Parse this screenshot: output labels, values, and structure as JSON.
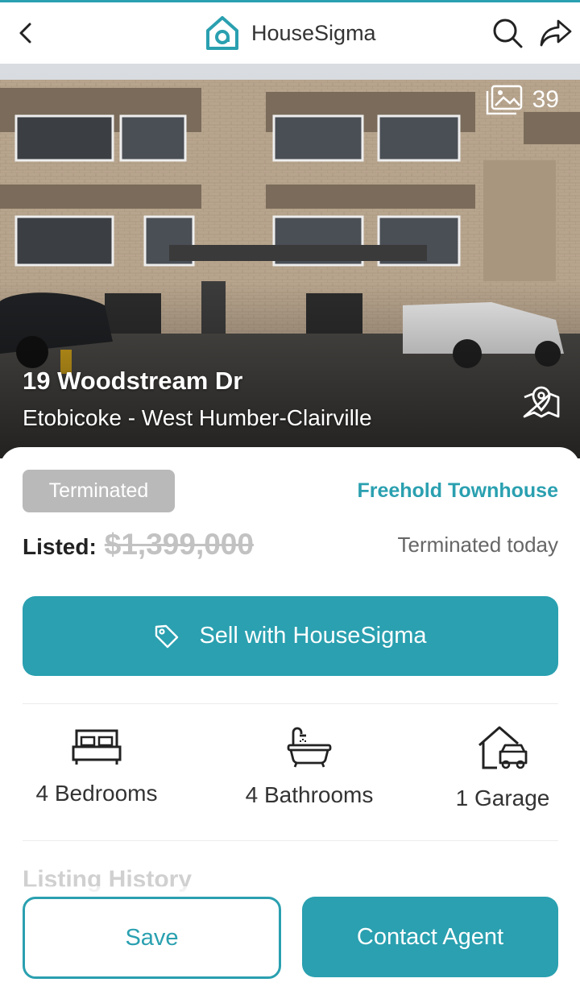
{
  "header": {
    "brand_name": "HouseSigma",
    "back_icon": "chevron-left-icon",
    "search_icon": "search-icon",
    "share_icon": "share-icon"
  },
  "hero": {
    "photo_count": "39",
    "address": "19 Woodstream Dr",
    "area": "Etobicoke - West Humber-Clairville"
  },
  "listing": {
    "status": "Terminated",
    "property_type": "Freehold Townhouse",
    "listed_label": "Listed:",
    "listed_price": "$1,399,000",
    "status_date": "Terminated today",
    "sell_button": "Sell with HouseSigma"
  },
  "features": [
    {
      "icon": "bed-icon",
      "label": "4 Bedrooms"
    },
    {
      "icon": "bathtub-icon",
      "label": "4 Bathrooms"
    },
    {
      "icon": "garage-icon",
      "label": "1 Garage"
    }
  ],
  "sections": {
    "history_title": "Listing History"
  },
  "actions": {
    "save_label": "Save",
    "contact_label": "Contact Agent"
  },
  "colors": {
    "accent": "#2aa0b0",
    "status_gray": "#b9b9b9"
  }
}
